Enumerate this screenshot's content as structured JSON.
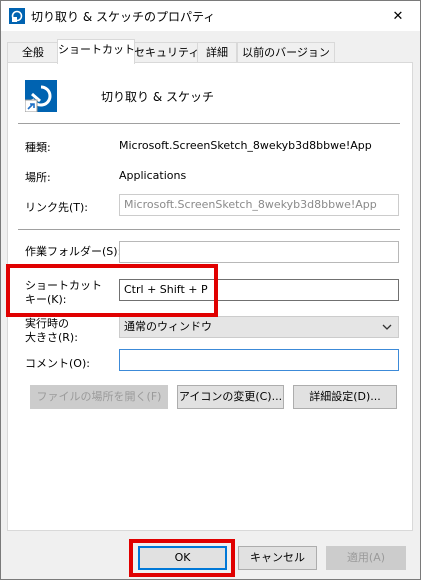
{
  "window": {
    "title": "切り取り & スケッチのプロパティ",
    "close_glyph": "✕"
  },
  "tabs": [
    {
      "label": "全般",
      "active": false
    },
    {
      "label": "ショートカット",
      "active": true
    },
    {
      "label": "セキュリティ",
      "active": false
    },
    {
      "label": "詳細",
      "active": false
    },
    {
      "label": "以前のバージョン",
      "active": false
    }
  ],
  "header": {
    "app_name": "切り取り & スケッチ",
    "icon": "snip-sketch-app-icon"
  },
  "fields": {
    "type_label": "種類:",
    "type_value": "Microsoft.ScreenSketch_8wekyb3d8bbwe!App",
    "location_label": "場所:",
    "location_value": "Applications",
    "target_label": "リンク先(T):",
    "target_value": "Microsoft.ScreenSketch_8wekyb3d8bbwe!App",
    "workdir_label": "作業フォルダー(S):",
    "workdir_value": "",
    "shortcut_label_line1": "ショートカット",
    "shortcut_label_line2": "キー(K):",
    "shortcut_value": "Ctrl + Shift + P",
    "run_label_line1": "実行時の",
    "run_label_line2": "大きさ(R):",
    "run_value": "通常のウィンドウ",
    "comment_label": "コメント(O):",
    "comment_value": ""
  },
  "buttons": {
    "open_location": "ファイルの場所を開く(F)",
    "change_icon": "アイコンの変更(C)...",
    "advanced": "詳細設定(D)...",
    "ok": "OK",
    "cancel": "キャンセル",
    "apply": "適用(A)"
  },
  "colors": {
    "highlight": "#e00000",
    "focus": "#0078d7",
    "icon_blue": "#0063b1"
  }
}
